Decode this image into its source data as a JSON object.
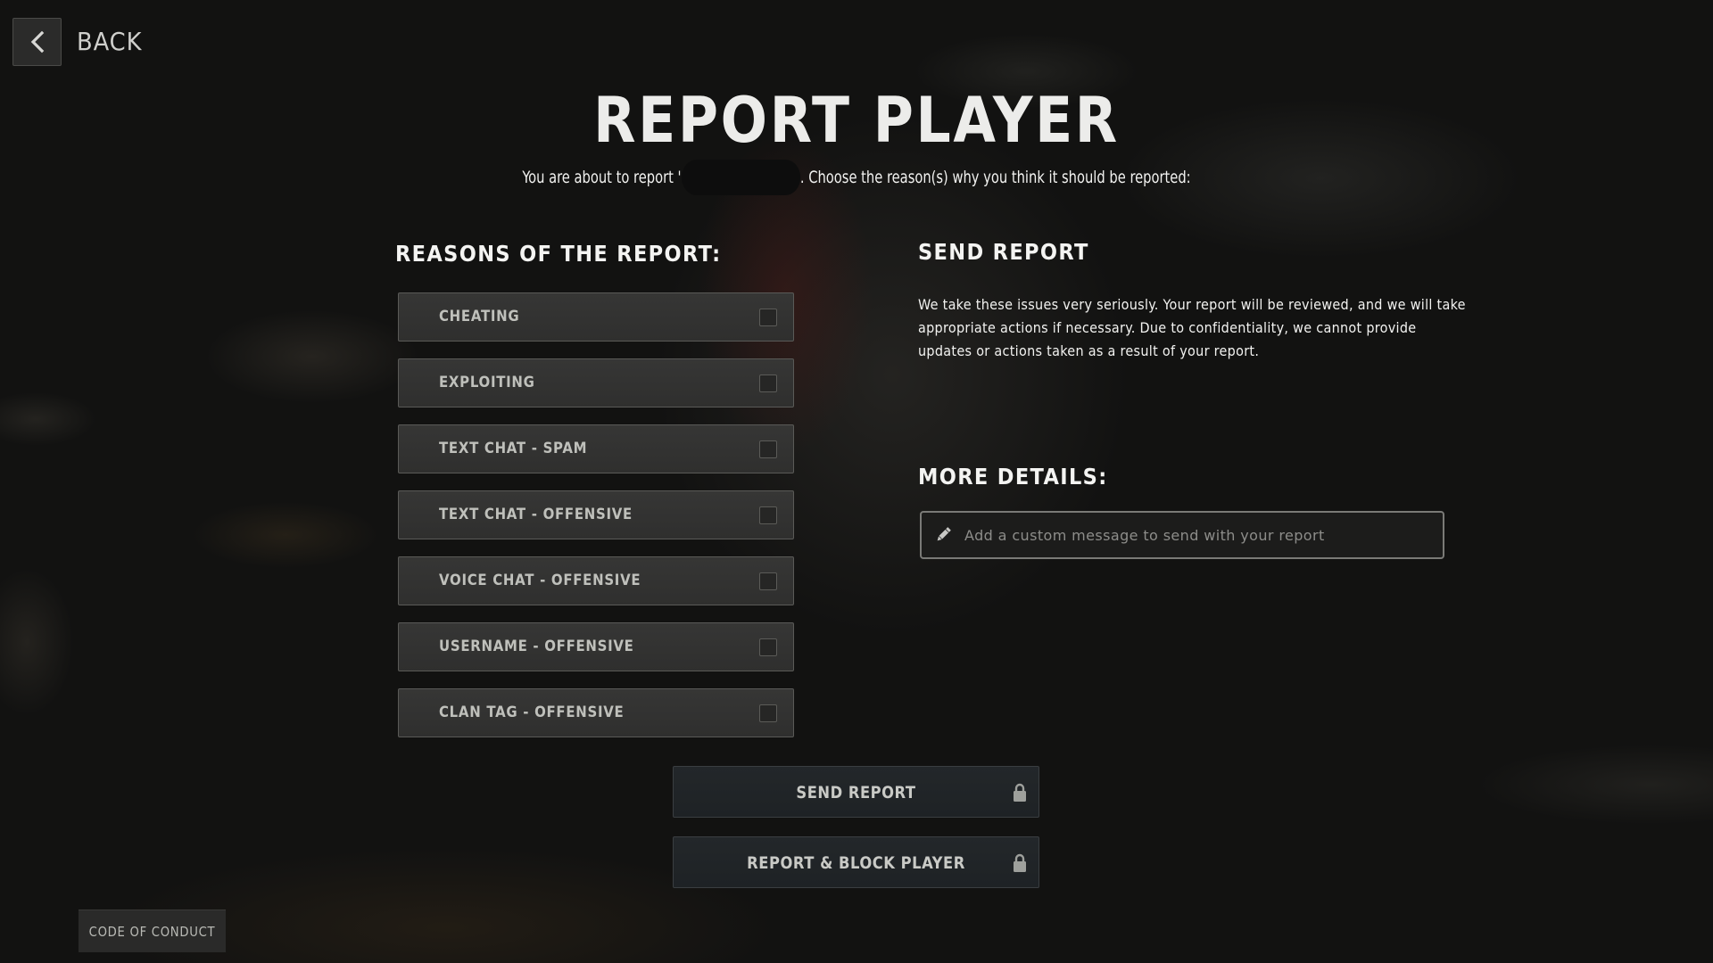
{
  "nav": {
    "back_label": "BACK"
  },
  "header": {
    "title": "REPORT PLAYER",
    "subtitle_before": "You are about to report '",
    "subtitle_after": ". Choose the reason(s) why you think it should be reported:"
  },
  "reasons": {
    "heading": "REASONS OF THE REPORT:",
    "items": [
      {
        "label": "CHEATING",
        "checked": false
      },
      {
        "label": "EXPLOITING",
        "checked": false
      },
      {
        "label": "TEXT CHAT - SPAM",
        "checked": false
      },
      {
        "label": "TEXT CHAT - OFFENSIVE",
        "checked": false
      },
      {
        "label": "VOICE CHAT - OFFENSIVE",
        "checked": false
      },
      {
        "label": "USERNAME - OFFENSIVE",
        "checked": false
      },
      {
        "label": "CLAN TAG - OFFENSIVE",
        "checked": false
      }
    ]
  },
  "send_report_info": {
    "heading": "SEND REPORT",
    "description": "We take these issues very seriously. Your report will be reviewed, and we will take appropriate actions if necessary. Due to confidentiality, we cannot provide updates or actions taken as a result of your report."
  },
  "more_details": {
    "heading": "MORE DETAILS:",
    "value": "",
    "placeholder": "Add a custom message to send with your report",
    "icon": "pencil-icon"
  },
  "actions": {
    "send_report_label": "SEND REPORT",
    "report_block_label": "REPORT & BLOCK PLAYER",
    "locked_icon": "lock-icon"
  },
  "footer": {
    "code_of_conduct_label": "CODE OF CONDUCT"
  }
}
